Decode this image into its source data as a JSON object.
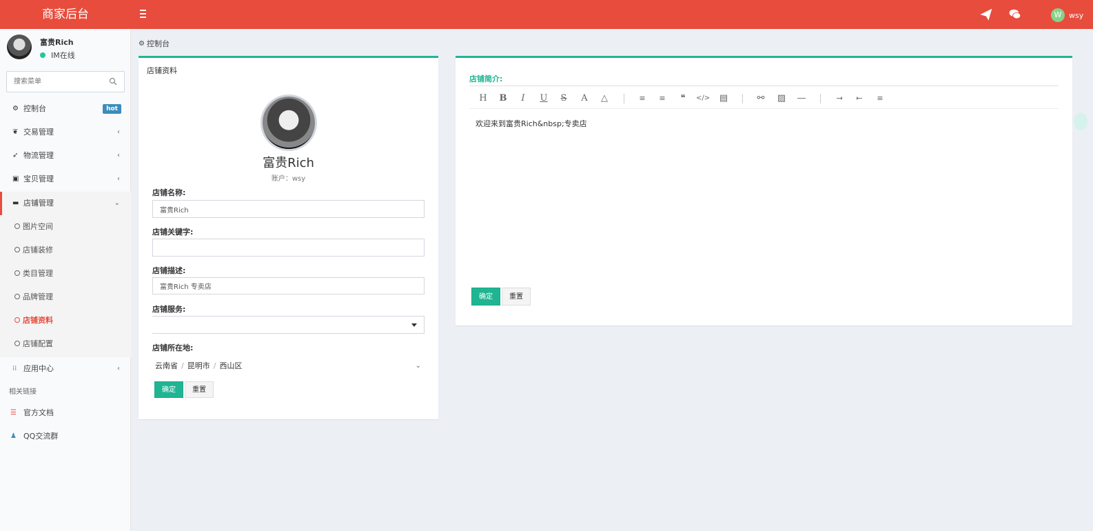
{
  "header": {
    "logo": "商家后台",
    "user_avatar_letter": "W",
    "user_name": "wsy"
  },
  "sidebar": {
    "user_name": "富贵Rich",
    "user_status": "IM在线",
    "search_placeholder": "搜索菜单",
    "items": [
      {
        "label": "控制台",
        "badge": "hot"
      },
      {
        "label": "交易管理"
      },
      {
        "label": "物流管理"
      },
      {
        "label": "宝贝管理"
      },
      {
        "label": "店铺管理"
      }
    ],
    "sub_items": [
      "图片空间",
      "店铺装修",
      "类目管理",
      "品牌管理",
      "店铺资料",
      "店铺配置"
    ],
    "app_center": "应用中心",
    "section_header": "相关链接",
    "links": [
      "官方文档",
      "QQ交流群"
    ]
  },
  "breadcrumb": "控制台",
  "profile": {
    "box_title": "店铺资料",
    "name": "富贵Rich",
    "account": "账户：wsy",
    "fields": {
      "store_name_label": "店铺名称:",
      "store_name_value": "富贵Rich",
      "keywords_label": "店铺关键字:",
      "keywords_value": "",
      "description_label": "店铺描述:",
      "description_value": "富贵Rich 专卖店",
      "service_label": "店铺服务:",
      "location_label": "店铺所在地:",
      "province": "云南省",
      "city": "昆明市",
      "district": "西山区"
    },
    "confirm": "确定",
    "reset": "重置"
  },
  "editor": {
    "title": "店铺简介:",
    "content": "欢迎来到富贵Rich&nbsp;专卖店",
    "confirm": "确定",
    "reset": "重置"
  }
}
